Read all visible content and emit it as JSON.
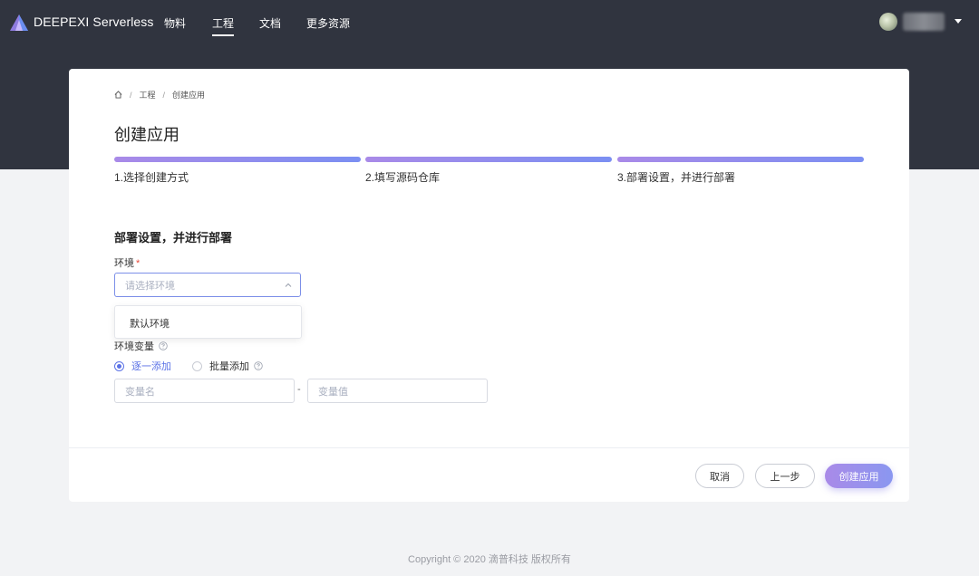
{
  "header": {
    "brand": "DEEPEXI Serverless",
    "menu": [
      "物料",
      "工程",
      "文档",
      "更多资源"
    ],
    "active_menu": "工程"
  },
  "breadcrumb": {
    "items": [
      "工程",
      "创建应用"
    ],
    "separator": "/"
  },
  "page_title": "创建应用",
  "steps": [
    {
      "label": "1.选择创建方式"
    },
    {
      "label": "2.填写源码仓库"
    },
    {
      "label": "3.部署设置，并进行部署"
    }
  ],
  "form": {
    "section_title": "部署设置，并进行部署",
    "env_label": "环境",
    "required_mark": "*",
    "env_placeholder": "请选择环境",
    "env_options": [
      "默认环境"
    ],
    "env_var_label": "环境变量",
    "radio_one": "逐一添加",
    "radio_batch": "批量添加",
    "var_name_placeholder": "变量名",
    "var_value_placeholder": "变量值",
    "dash": "-"
  },
  "actions": {
    "cancel": "取消",
    "prev": "上一步",
    "create": "创建应用"
  },
  "footer": "Copyright © 2020 滴普科技 版权所有",
  "colors": {
    "topbar": "#30343f",
    "accent": "#5b72e6",
    "gradient_start": "#a98ae8",
    "gradient_end": "#7b8ff2",
    "required": "#e84a3b"
  },
  "icons": [
    "logo-icon",
    "home-icon",
    "chevron-up-icon",
    "question-circle-icon",
    "caret-down-icon"
  ]
}
